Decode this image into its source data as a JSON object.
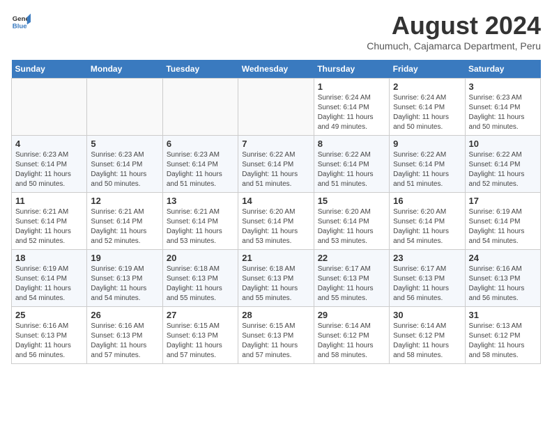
{
  "header": {
    "logo_general": "General",
    "logo_blue": "Blue",
    "title": "August 2024",
    "subtitle": "Chumuch, Cajamarca Department, Peru"
  },
  "days_of_week": [
    "Sunday",
    "Monday",
    "Tuesday",
    "Wednesday",
    "Thursday",
    "Friday",
    "Saturday"
  ],
  "weeks": [
    [
      {
        "day": "",
        "info": ""
      },
      {
        "day": "",
        "info": ""
      },
      {
        "day": "",
        "info": ""
      },
      {
        "day": "",
        "info": ""
      },
      {
        "day": "1",
        "info": "Sunrise: 6:24 AM\nSunset: 6:14 PM\nDaylight: 11 hours and 49 minutes."
      },
      {
        "day": "2",
        "info": "Sunrise: 6:24 AM\nSunset: 6:14 PM\nDaylight: 11 hours and 50 minutes."
      },
      {
        "day": "3",
        "info": "Sunrise: 6:23 AM\nSunset: 6:14 PM\nDaylight: 11 hours and 50 minutes."
      }
    ],
    [
      {
        "day": "4",
        "info": "Sunrise: 6:23 AM\nSunset: 6:14 PM\nDaylight: 11 hours and 50 minutes."
      },
      {
        "day": "5",
        "info": "Sunrise: 6:23 AM\nSunset: 6:14 PM\nDaylight: 11 hours and 50 minutes."
      },
      {
        "day": "6",
        "info": "Sunrise: 6:23 AM\nSunset: 6:14 PM\nDaylight: 11 hours and 51 minutes."
      },
      {
        "day": "7",
        "info": "Sunrise: 6:22 AM\nSunset: 6:14 PM\nDaylight: 11 hours and 51 minutes."
      },
      {
        "day": "8",
        "info": "Sunrise: 6:22 AM\nSunset: 6:14 PM\nDaylight: 11 hours and 51 minutes."
      },
      {
        "day": "9",
        "info": "Sunrise: 6:22 AM\nSunset: 6:14 PM\nDaylight: 11 hours and 51 minutes."
      },
      {
        "day": "10",
        "info": "Sunrise: 6:22 AM\nSunset: 6:14 PM\nDaylight: 11 hours and 52 minutes."
      }
    ],
    [
      {
        "day": "11",
        "info": "Sunrise: 6:21 AM\nSunset: 6:14 PM\nDaylight: 11 hours and 52 minutes."
      },
      {
        "day": "12",
        "info": "Sunrise: 6:21 AM\nSunset: 6:14 PM\nDaylight: 11 hours and 52 minutes."
      },
      {
        "day": "13",
        "info": "Sunrise: 6:21 AM\nSunset: 6:14 PM\nDaylight: 11 hours and 53 minutes."
      },
      {
        "day": "14",
        "info": "Sunrise: 6:20 AM\nSunset: 6:14 PM\nDaylight: 11 hours and 53 minutes."
      },
      {
        "day": "15",
        "info": "Sunrise: 6:20 AM\nSunset: 6:14 PM\nDaylight: 11 hours and 53 minutes."
      },
      {
        "day": "16",
        "info": "Sunrise: 6:20 AM\nSunset: 6:14 PM\nDaylight: 11 hours and 54 minutes."
      },
      {
        "day": "17",
        "info": "Sunrise: 6:19 AM\nSunset: 6:14 PM\nDaylight: 11 hours and 54 minutes."
      }
    ],
    [
      {
        "day": "18",
        "info": "Sunrise: 6:19 AM\nSunset: 6:14 PM\nDaylight: 11 hours and 54 minutes."
      },
      {
        "day": "19",
        "info": "Sunrise: 6:19 AM\nSunset: 6:13 PM\nDaylight: 11 hours and 54 minutes."
      },
      {
        "day": "20",
        "info": "Sunrise: 6:18 AM\nSunset: 6:13 PM\nDaylight: 11 hours and 55 minutes."
      },
      {
        "day": "21",
        "info": "Sunrise: 6:18 AM\nSunset: 6:13 PM\nDaylight: 11 hours and 55 minutes."
      },
      {
        "day": "22",
        "info": "Sunrise: 6:17 AM\nSunset: 6:13 PM\nDaylight: 11 hours and 55 minutes."
      },
      {
        "day": "23",
        "info": "Sunrise: 6:17 AM\nSunset: 6:13 PM\nDaylight: 11 hours and 56 minutes."
      },
      {
        "day": "24",
        "info": "Sunrise: 6:16 AM\nSunset: 6:13 PM\nDaylight: 11 hours and 56 minutes."
      }
    ],
    [
      {
        "day": "25",
        "info": "Sunrise: 6:16 AM\nSunset: 6:13 PM\nDaylight: 11 hours and 56 minutes."
      },
      {
        "day": "26",
        "info": "Sunrise: 6:16 AM\nSunset: 6:13 PM\nDaylight: 11 hours and 57 minutes."
      },
      {
        "day": "27",
        "info": "Sunrise: 6:15 AM\nSunset: 6:13 PM\nDaylight: 11 hours and 57 minutes."
      },
      {
        "day": "28",
        "info": "Sunrise: 6:15 AM\nSunset: 6:13 PM\nDaylight: 11 hours and 57 minutes."
      },
      {
        "day": "29",
        "info": "Sunrise: 6:14 AM\nSunset: 6:12 PM\nDaylight: 11 hours and 58 minutes."
      },
      {
        "day": "30",
        "info": "Sunrise: 6:14 AM\nSunset: 6:12 PM\nDaylight: 11 hours and 58 minutes."
      },
      {
        "day": "31",
        "info": "Sunrise: 6:13 AM\nSunset: 6:12 PM\nDaylight: 11 hours and 58 minutes."
      }
    ]
  ]
}
